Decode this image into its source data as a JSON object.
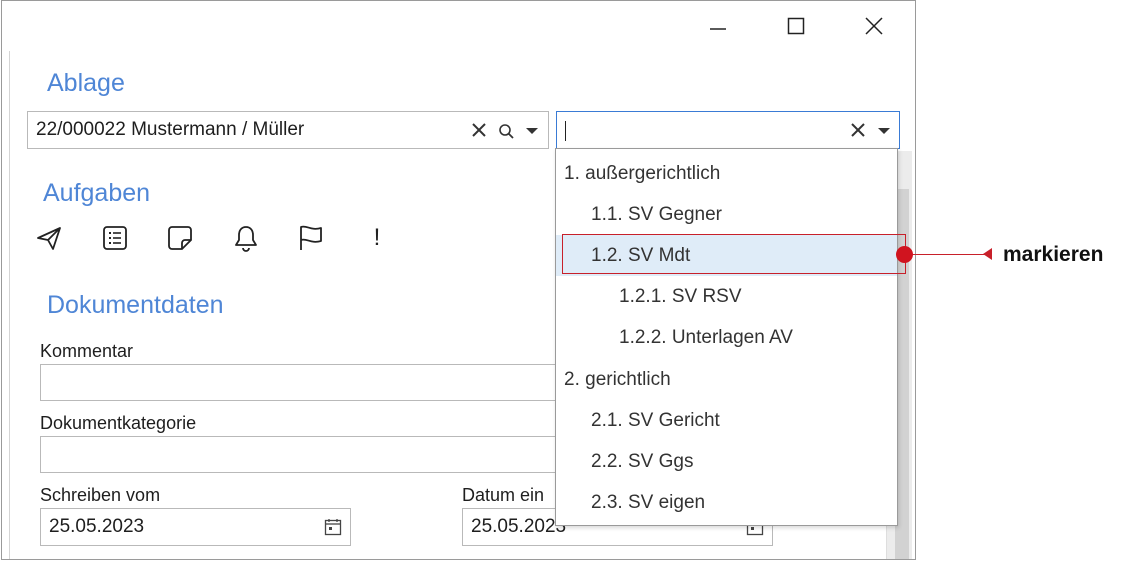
{
  "window": {
    "minimize_icon": "minimize-icon",
    "maximize_icon": "maximize-icon",
    "close_icon": "close-icon"
  },
  "ablage": {
    "title": "Ablage",
    "file_value": "22/000022 Mustermann / Müller",
    "folder_value": ""
  },
  "aufgaben": {
    "title": "Aufgaben",
    "icons": [
      "send-icon",
      "list-icon",
      "note-icon",
      "bell-icon",
      "flag-icon",
      "exclamation-icon"
    ],
    "exclamation_glyph": "!"
  },
  "dokumentdaten": {
    "title": "Dokumentdaten",
    "kommentar_label": "Kommentar",
    "kommentar_value": "",
    "kategorie_label": "Dokumentkategorie",
    "kategorie_value": "",
    "schreiben_label": "Schreiben vom",
    "schreiben_value": "25.05.2023",
    "datum_label": "Datum ein",
    "datum_value": "25.05.2023"
  },
  "dropdown": {
    "items": [
      {
        "label": "1. außergerichtlich",
        "level": 0
      },
      {
        "label": "1.1. SV Gegner",
        "level": 1
      },
      {
        "label": "1.2. SV Mdt",
        "level": 1,
        "selected": true
      },
      {
        "label": "1.2.1. SV RSV",
        "level": 2
      },
      {
        "label": "1.2.2. Unterlagen AV",
        "level": 2
      },
      {
        "label": "2. gerichtlich",
        "level": 0
      },
      {
        "label": "2.1. SV Gericht",
        "level": 1
      },
      {
        "label": "2.2. SV Ggs",
        "level": 1
      },
      {
        "label": "2.3. SV eigen",
        "level": 1
      }
    ]
  },
  "annotation": {
    "text": "markieren",
    "color": "#c8202a"
  },
  "colors": {
    "accent": "#4f86d6",
    "selection": "#dfecf8",
    "focus_border": "#3a7bd5"
  }
}
